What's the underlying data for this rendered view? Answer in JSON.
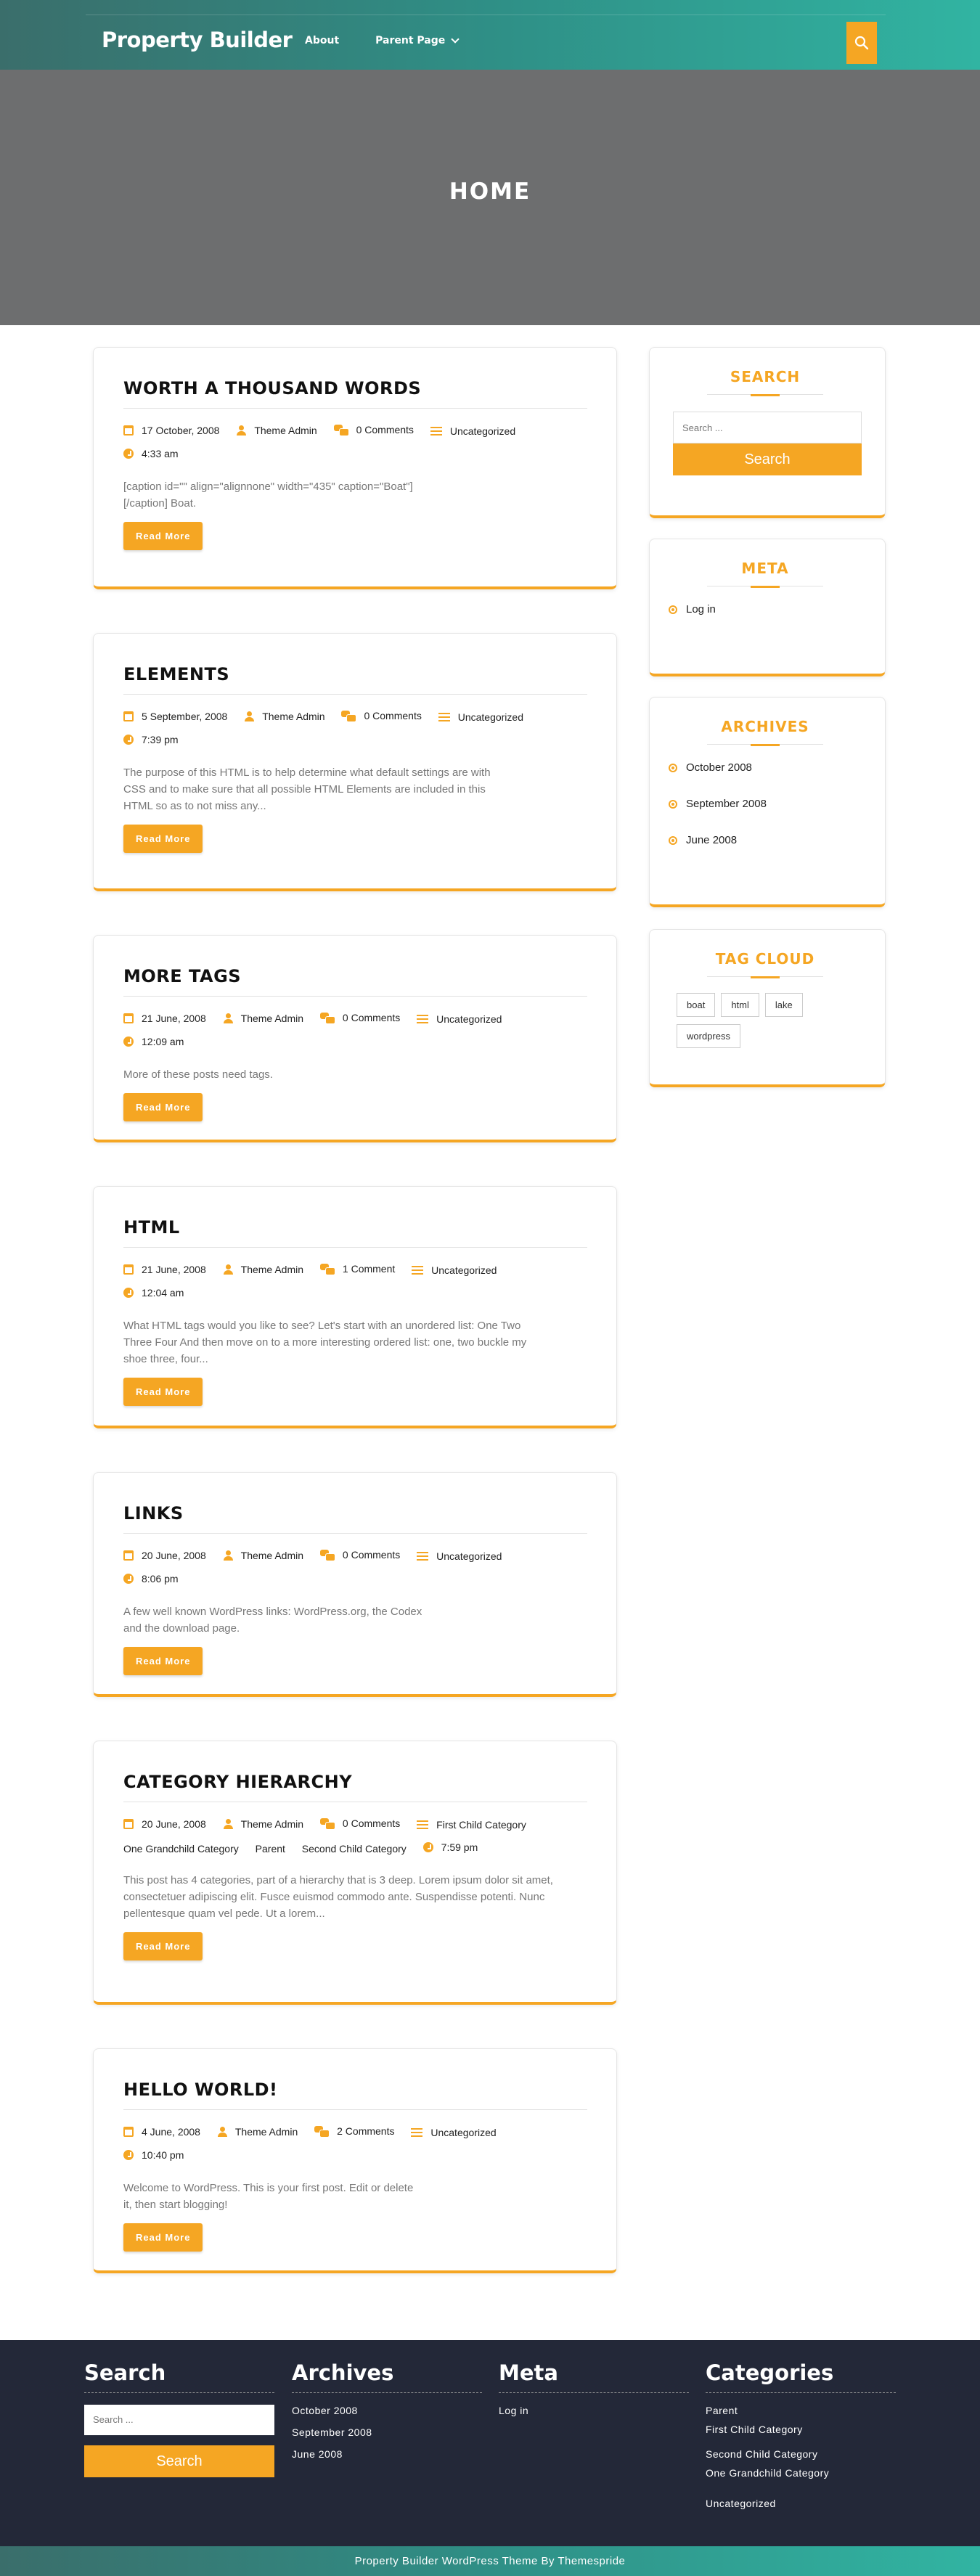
{
  "site": {
    "brand": "Property Builder",
    "nav": [
      {
        "label": "About"
      },
      {
        "label": "Parent Page"
      }
    ]
  },
  "hero": {
    "title": "HOME"
  },
  "posts": [
    {
      "title": "WORTH A THOUSAND WORDS",
      "date": "17 October, 2008",
      "author": "Theme Admin",
      "comments": "0 Comments",
      "categories": [
        "Uncategorized"
      ],
      "time": "4:33 am",
      "excerpt": "[caption id=\"\" align=\"alignnone\" width=\"435\" caption=\"Boat\"][/caption] Boat.",
      "read_more": "Read More"
    },
    {
      "title": "ELEMENTS",
      "date": "5 September, 2008",
      "author": "Theme Admin",
      "comments": "0 Comments",
      "categories": [
        "Uncategorized"
      ],
      "time": "7:39 pm",
      "excerpt": "The purpose of this HTML is to help determine what default settings are with CSS and to make sure that all possible HTML Elements are included in this HTML so as to not miss any...",
      "read_more": "Read More"
    },
    {
      "title": "MORE TAGS",
      "date": "21 June, 2008",
      "author": "Theme Admin",
      "comments": "0 Comments",
      "categories": [
        "Uncategorized"
      ],
      "time": "12:09 am",
      "excerpt": "More of these posts need tags.",
      "read_more": "Read More"
    },
    {
      "title": "HTML",
      "date": "21 June, 2008",
      "author": "Theme Admin",
      "comments": "1 Comment",
      "categories": [
        "Uncategorized"
      ],
      "time": "12:04 am",
      "excerpt": "What HTML tags would you like to see? Let's start with an unordered list: One Two Three Four And then move on to a more interesting ordered list: one, two buckle my shoe three, four...",
      "read_more": "Read More"
    },
    {
      "title": "LINKS",
      "date": "20 June, 2008",
      "author": "Theme Admin",
      "comments": "0 Comments",
      "categories": [
        "Uncategorized"
      ],
      "time": "8:06 pm",
      "excerpt": "A few well known WordPress links: WordPress.org, the Codex and the download page.",
      "read_more": "Read More"
    },
    {
      "title": "CATEGORY HIERARCHY",
      "date": "20 June, 2008",
      "author": "Theme Admin",
      "comments": "0 Comments",
      "categories": [
        "First Child Category",
        "One Grandchild Category",
        "Parent",
        "Second Child Category"
      ],
      "time": "7:59 pm",
      "excerpt": "This post has 4 categories, part of a hierarchy that is 3 deep. Lorem ipsum dolor sit amet, consectetuer adipiscing elit. Fusce euismod commodo ante. Suspendisse potenti. Nunc pellentesque quam vel pede. Ut a lorem...",
      "read_more": "Read More"
    },
    {
      "title": "HELLO WORLD!",
      "date": "4 June, 2008",
      "author": "Theme Admin",
      "comments": "2 Comments",
      "categories": [
        "Uncategorized"
      ],
      "time": "10:40 pm",
      "excerpt": "Welcome to WordPress. This is your first post. Edit or delete it, then start blogging!",
      "read_more": "Read More"
    }
  ],
  "sidebar": {
    "search": {
      "title": "SEARCH",
      "placeholder": "Search ...",
      "button": "Search"
    },
    "meta": {
      "title": "META",
      "items": [
        "Log in"
      ]
    },
    "archives": {
      "title": "ARCHIVES",
      "items": [
        "October 2008",
        "September 2008",
        "June 2008"
      ]
    },
    "tag_cloud": {
      "title": "TAG CLOUD",
      "tags": [
        "boat",
        "html",
        "lake",
        "wordpress"
      ]
    }
  },
  "footer": {
    "search": {
      "title": "Search",
      "placeholder": "Search ...",
      "button": "Search"
    },
    "archives": {
      "title": "Archives",
      "items": [
        "October 2008",
        "September 2008",
        "June 2008"
      ]
    },
    "meta": {
      "title": "Meta",
      "items": [
        "Log in"
      ]
    },
    "categories": {
      "title": "Categories",
      "items": [
        "Parent",
        "First Child Category",
        "Second Child Category",
        "One Grandchild Category",
        "Uncategorized"
      ]
    },
    "copyright": "Property Builder WordPress Theme By Themespride"
  },
  "colors": {
    "accent": "#f5a623",
    "header_start": "#3a6e6b",
    "header_end": "#31b4a2",
    "footer_bg": "#232838",
    "hero_bg": "#6d6e6f"
  }
}
